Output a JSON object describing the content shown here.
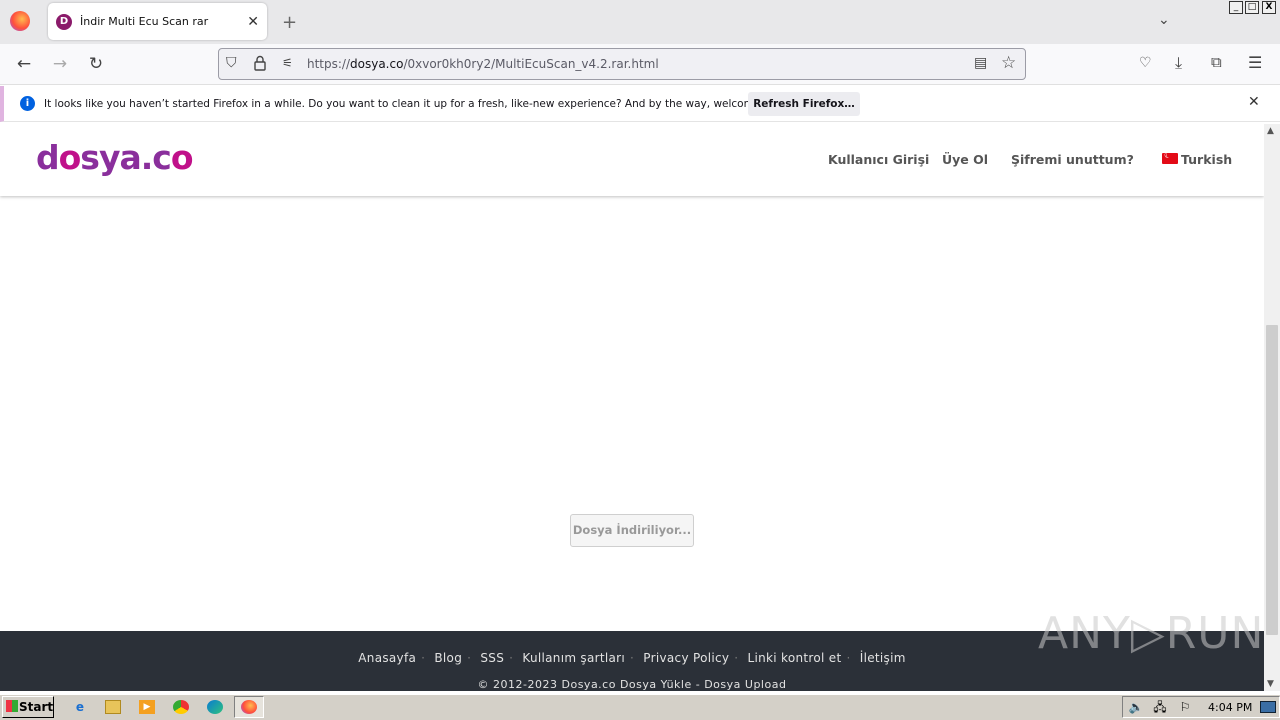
{
  "browser": {
    "tab_title": "İndir Multi Ecu Scan rar",
    "tab_favicon": "D",
    "url_domain": "dosya.co",
    "url_prefix": "https://",
    "url_path": "/0xvor0kh0ry2/MultiEcuScan_v4.2.rar.html",
    "window_controls": [
      "_",
      "□",
      "X"
    ]
  },
  "notification": {
    "message": "It looks like you haven’t started Firefox in a while. Do you want to clean it up for a fresh, like-new experience? And by the way, welcome back!",
    "button": "Refresh Firefox…"
  },
  "site": {
    "logo": {
      "part1": "d",
      "part2": "o",
      "part3": "sya.c",
      "part4": "o"
    },
    "menu": [
      "Kullanıcı Girişi",
      "Üye Ol",
      "Şifremi unuttum?",
      "Turkish"
    ],
    "download_button": "Dosya İndiriliyor...",
    "footer_links": [
      "Anasayfa",
      "Blog",
      "SSS",
      "Kullanım şartları",
      "Privacy Policy",
      "Linki kontrol et",
      "İletişim"
    ],
    "copyright": "© 2012-2023 Dosya.co Dosya Yükle - Dosya Upload",
    "watermark": "ANY▷RUN"
  },
  "taskbar": {
    "start": "Start",
    "clock": "4:04 PM"
  }
}
